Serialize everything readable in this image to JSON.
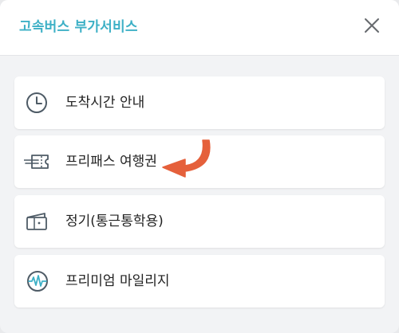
{
  "header": {
    "title": "고속버스 부가서비스",
    "close_icon": "close-icon"
  },
  "menu": {
    "items": [
      {
        "label": "도착시간 안내",
        "icon": "clock-icon"
      },
      {
        "label": "프리패스 여행권",
        "icon": "ticket-icon"
      },
      {
        "label": "정기(통근통학용)",
        "icon": "wallet-icon"
      },
      {
        "label": "프리미엄 마일리지",
        "icon": "mileage-icon"
      }
    ]
  },
  "annotation": {
    "icon": "curved-arrow-icon",
    "color": "#e5603b"
  },
  "colors": {
    "accent": "#3db0c6",
    "icon_stroke": "#4e5b66",
    "background": "#f2f3f5"
  }
}
